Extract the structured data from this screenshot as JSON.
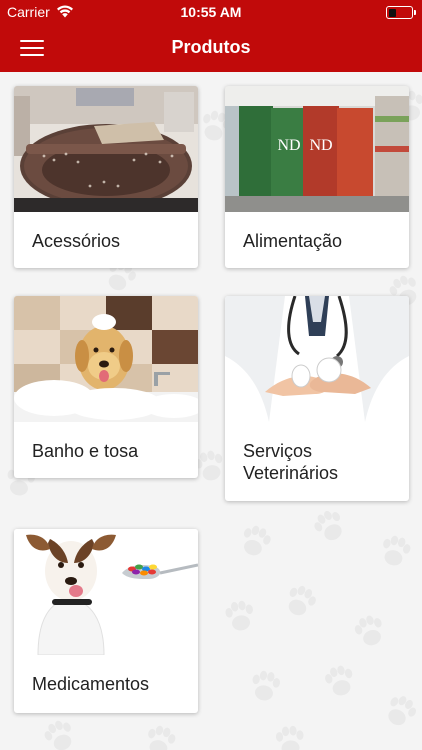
{
  "status_bar": {
    "carrier": "Carrier",
    "time": "10:55 AM",
    "battery_level": 0.35
  },
  "nav": {
    "title": "Produtos",
    "menu_icon": "hamburger-menu-icon"
  },
  "colors": {
    "brand_red": "#c10a0a",
    "background": "#f4f4f4",
    "card": "#ffffff"
  },
  "categories": [
    {
      "label": "Acessórios",
      "image": "pet-bed-photo"
    },
    {
      "label": "Alimentação",
      "image": "pet-food-bags-photo"
    },
    {
      "label": "Banho e tosa",
      "image": "dog-bath-photo"
    },
    {
      "label_line1": "Serviços",
      "label_line2": "Veterinários",
      "image": "veterinarian-hands-photo"
    },
    {
      "label": "Medicamentos",
      "image": "dog-medicine-photo"
    }
  ]
}
